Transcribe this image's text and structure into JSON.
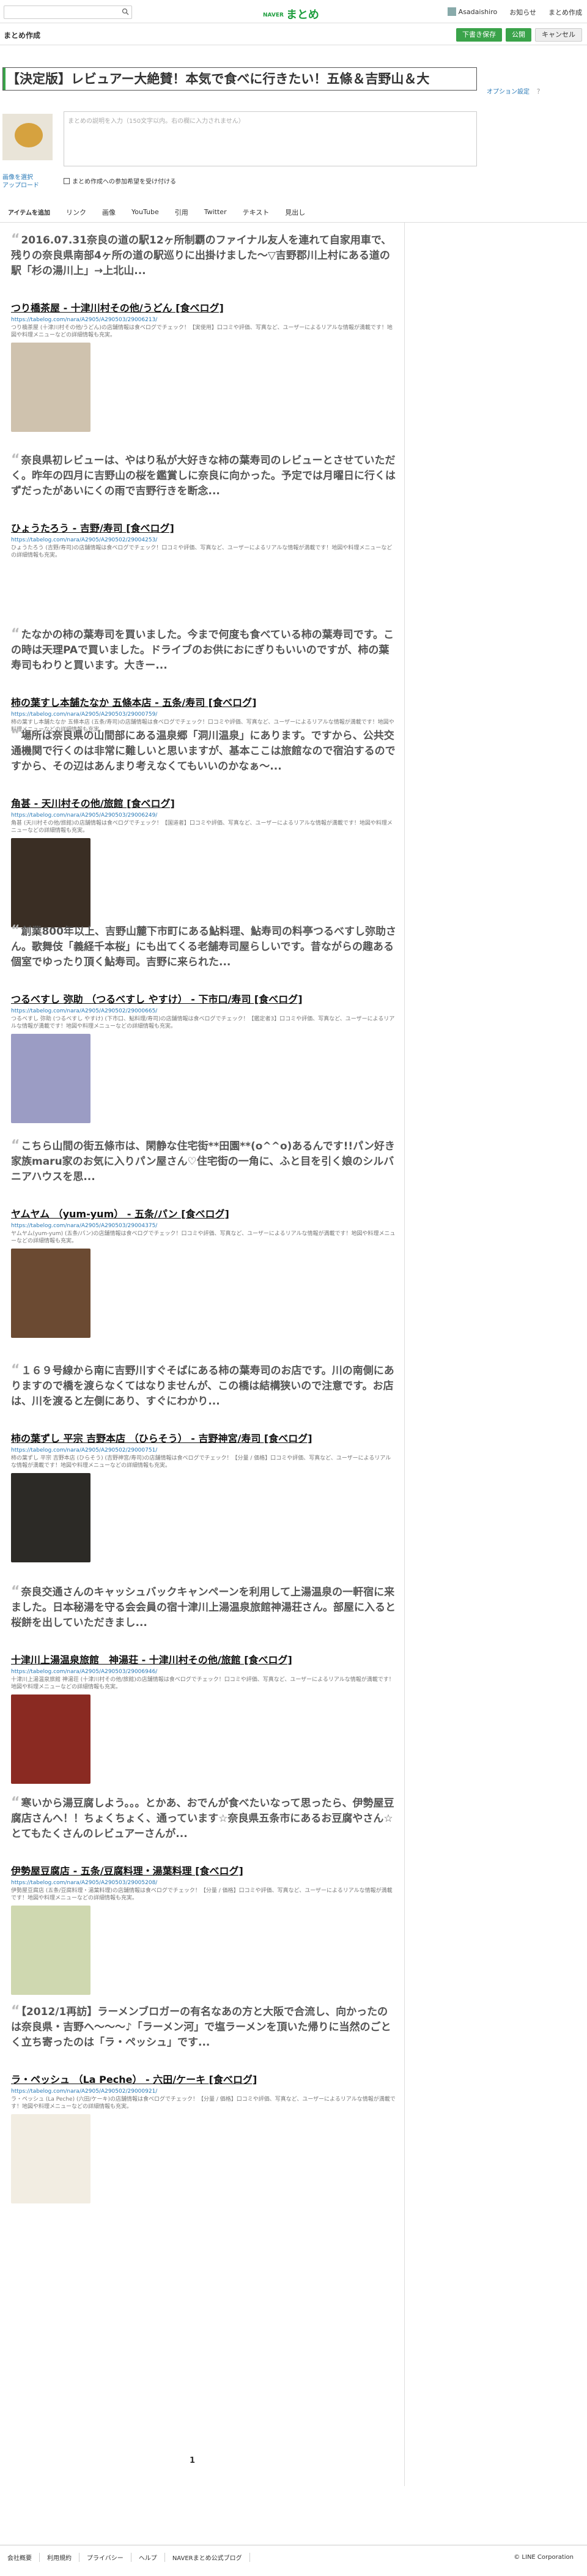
{
  "header": {
    "logo_small": "NAVER",
    "logo": "まとめ",
    "user": "Asadaishiro",
    "notice": "お知らせ",
    "create": "まとめ作成"
  },
  "subbar": {
    "title": "まとめ作成",
    "save": "下書き保存",
    "publish": "公開",
    "cancel": "キャンセル"
  },
  "editor": {
    "title": "【決定版】レビュアー大絶賛！本気で食べに行きたい！五條＆吉野山＆大",
    "option": "オプション設定",
    "help": "？",
    "desc_placeholder": "まとめの説明を入力（150文字以内。右の欄に入力されません）",
    "change_image": "画像を選択",
    "upload": "アップロード",
    "checkbox": "まとめ作成への参加希望を受け付ける"
  },
  "tabs": [
    "アイテムを追加",
    "リンク",
    "画像",
    "YouTube",
    "引用",
    "Twitter",
    "テキスト",
    "見出し"
  ],
  "items": [
    {
      "quote": "2016.07.31奈良の道の駅12ヶ所制覇のファイナル友人を連れて自家用車で、残りの奈良県南部4ヶ所の道の駅巡りに出掛けました〜▽吉野郡川上村にある道の駅「杉の湯川上」→上北山...",
      "link": "つり橋茶屋 - 十津川村その他/うどん [食べログ]",
      "url": "https://tabelog.com/nara/A2905/A290503/29006213/",
      "desc": "つり橋茶屋 (十津川村その他/うどん)の店舗情報は食べログでチェック！【実使用】口コミや評価、写真など、ユーザーによるリアルな情報が満載です！地図や料理メニューなどの詳細情報も充実。",
      "photo": "#cfc2ae"
    },
    {
      "quote": "奈良県初レビューは、やはり私が大好きな柿の葉寿司のレビューとさせていただく。昨年の四月に吉野山の桜を鑑賞しに奈良に向かった。予定では月曜日に行くはずだったがあいにくの雨で吉野行きを断念...",
      "link": "ひょうたろう - 吉野/寿司 [食べログ]",
      "url": "https://tabelog.com/nara/A2905/A290502/29004253/",
      "desc": "ひょうたろう (吉野/寿司)の店舗情報は食べログでチェック！口コミや評価、写真など、ユーザーによるリアルな情報が満載です！地図や料理メニューなどの詳細情報も充実。",
      "photo": ""
    },
    {
      "quote": "たなかの柿の葉寿司を買いました。今まで何度も食べている柿の葉寿司です。この時は天理PAで買いました。ドライブのお供におにぎりもいいのですが、柿の葉寿司もわりと買います。大きー...",
      "link": "柿の葉すし本舗たなか 五條本店 - 五条/寿司 [食べログ]",
      "url": "https://tabelog.com/nara/A2905/A290503/29000759/",
      "desc": "柿の葉すし本舗たなか 五條本店 (五条/寿司)の店舗情報は食べログでチェック！口コミや評価、写真など、ユーザーによるリアルな情報が満載です！地図や料理メニューなどの詳細情報も充実。",
      "photo": ""
    },
    {
      "quote": "場所は奈良県の山間部にある温泉郷「洞川温泉」にあります。ですから、公共交通機関で行くのは非常に難しいと思いますが、基本ここは旅館なので宿泊するのですから、その辺はあんまり考えなくてもいいのかなぁ〜...",
      "link": "角甚 - 天川村その他/旅館 [食べログ]",
      "url": "https://tabelog.com/nara/A2905/A290503/29006249/",
      "desc": "角甚 (天川村その他/旅館)の店舗情報は食べログでチェック！【国道者】口コミや評価、写真など、ユーザーによるリアルな情報が満載です！地図や料理メニューなどの詳細情報も充実。",
      "photo": "#3a2e24"
    },
    {
      "quote": "創業800年以上、吉野山麓下市町にある鮎料理、鮎寿司の料亭つるべすし弥助さん。歌舞伎「義経千本桜」にも出てくる老舗寿司屋らしいです。昔ながらの趣ある個室でゆったり頂く鮎寿司。吉野に来られた...",
      "link": "つるべすし 弥助 （つるべすし やすけ） - 下市口/寿司 [食べログ]",
      "url": "https://tabelog.com/nara/A2905/A290502/29000665/",
      "desc": "つるべすし 弥助 (つるべすし やすけ) (下市口、鮎料理/寿司)の店舗情報は食べログでチェック！【鑑定者3】口コミや評価、写真など、ユーザーによるリアルな情報が満載です！地図や料理メニューなどの詳細情報も充実。",
      "photo": "#9b9cc4"
    },
    {
      "quote": "こちら山間の街五條市は、閑静な住宅街**田園**(o^^o)あるんです!!パン好き家族maru家のお気に入りパン屋さん♡住宅街の一角に、ふと目を引く娘のシルバニアハウスを思...",
      "link": "ヤムヤム （yum-yum） - 五条/パン [食べログ]",
      "url": "https://tabelog.com/nara/A2905/A290503/29004375/",
      "desc": "ヤムヤム(yum-yum) (五条/パン)の店舗情報は食べログでチェック！口コミや評価、写真など、ユーザーによるリアルな情報が満載です！地図や料理メニューなどの詳細情報も充実。",
      "photo": "#6b4a32"
    },
    {
      "quote": "１６９号線から南に吉野川すぐそばにある柿の葉寿司のお店です。川の南側にありますので橋を渡らなくてはなりませんが、この橋は結構狭いので注意です。お店は、川を渡ると左側にあり、すぐにわかり...",
      "link": "柿の葉ずし 平宗 吉野本店 （ひらそう） - 吉野神宮/寿司 [食べログ]",
      "url": "https://tabelog.com/nara/A2905/A290502/29000751/",
      "desc": "柿の葉ずし 平宗 吉野本店 (ひらそう) (吉野神宮/寿司)の店舗情報は食べログでチェック！【分量 / 価格】口コミや評価、写真など、ユーザーによるリアルな情報が満載です！地図や料理メニューなどの詳細情報も充実。",
      "photo": "#2c2a26"
    },
    {
      "quote": "奈良交通さんのキャッシュバックキャンペーンを利用して上湯温泉の一軒宿に来ました。日本秘湯を守る会会員の宿十津川上湯温泉旅館神湯荘さん。部屋に入ると桜餅を出していただきまし...",
      "link": "十津川上湯温泉旅館　神湯荘 - 十津川村その他/旅館 [食べログ]",
      "url": "https://tabelog.com/nara/A2905/A290503/29006946/",
      "desc": "十津川上湯温泉旅館 神湯荘 (十津川村その他/旅館)の店舗情報は食べログでチェック！口コミや評価、写真など、ユーザーによるリアルな情報が満載です！地図や料理メニューなどの詳細情報も充実。",
      "photo": "#8a2a22"
    },
    {
      "quote": "寒いから湯豆腐しよう。。。とかあ、おでんが食べたいなって思ったら、伊勢屋豆腐店さんへ！！ちょくちょく、通っています☆奈良県五条市にあるお豆腐やさん☆とてもたくさんのレビュアーさんが...",
      "link": "伊勢屋豆腐店 - 五条/豆腐料理・湯葉料理 [食べログ]",
      "url": "https://tabelog.com/nara/A2905/A290503/29005208/",
      "desc": "伊勢屋豆腐店 (五条/豆腐料理・湯葉料理)の店舗情報は食べログでチェック！【分量 / 価格】口コミや評価、写真など、ユーザーによるリアルな情報が満載です！地図や料理メニューなどの詳細情報も充実。",
      "photo": "#cfd8b0"
    },
    {
      "quote": "【2012/1再訪】ラーメンブロガーの有名なあの方と大阪で合流し、向かったのは奈良県・吉野へ〜〜〜♪「ラーメン河」で塩ラーメンを頂いた帰りに当然のごとく立ち寄ったのは「ラ・ペッシュ」です...",
      "link": "ラ・ペッシュ （La Peche） - 六田/ケーキ [食べログ]",
      "url": "https://tabelog.com/nara/A2905/A290502/29000921/",
      "desc": "ラ・ペッシュ (La Peche) (六田/ケーキ)の店舗情報は食べログでチェック！【分量 / 価格】口コミや評価、写真など、ユーザーによるリアルな情報が満載です！地図や料理メニューなどの詳細情報も充実。",
      "photo": "#f2ede2"
    }
  ],
  "pager": "1",
  "footer": {
    "links": [
      "会社概要",
      "利用規約",
      "プライバシー",
      "ヘルプ",
      "NAVERまとめ公式ブログ"
    ],
    "copyright": "© LINE Corporation"
  }
}
